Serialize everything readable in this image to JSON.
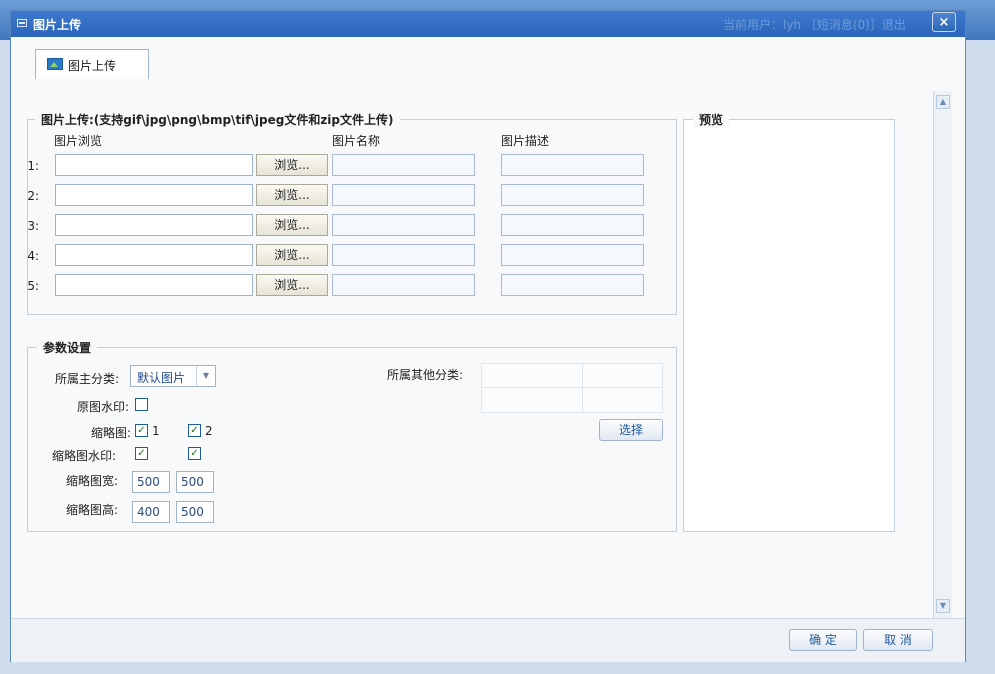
{
  "header": {
    "title": "图片上传",
    "background_user_text": "当前用户：lyh ［短消息(0)］退出",
    "close_symbol": "×"
  },
  "tab": {
    "label": "图片上传"
  },
  "upload": {
    "legend": "图片上传:(支持gif\\jpg\\png\\bmp\\tif\\jpeg文件和zip文件上传)",
    "col_browse": "图片浏览",
    "col_name": "图片名称",
    "col_desc": "图片描述",
    "browse_label": "浏览...",
    "rows": [
      "1:",
      "2:",
      "3:",
      "4:",
      "5:"
    ]
  },
  "preview": {
    "legend": "预览"
  },
  "params": {
    "legend": "参数设置",
    "main_category_label": "所属主分类:",
    "main_category_value": "默认图片",
    "other_category_label": "所属其他分类:",
    "watermark_label": "原图水印:",
    "thumb_label": "缩略图:",
    "thumb1": "1",
    "thumb2": "2",
    "thumb_watermark_label": "缩略图水印:",
    "thumb_width_label": "缩略图宽:",
    "thumb_width_1": "500",
    "thumb_width_2": "500",
    "thumb_height_label": "缩略图高:",
    "thumb_height_1": "400",
    "thumb_height_2": "500",
    "select_button": "选择",
    "checkmark": "✓"
  },
  "footer": {
    "ok": "确 定",
    "cancel": "取 消"
  }
}
